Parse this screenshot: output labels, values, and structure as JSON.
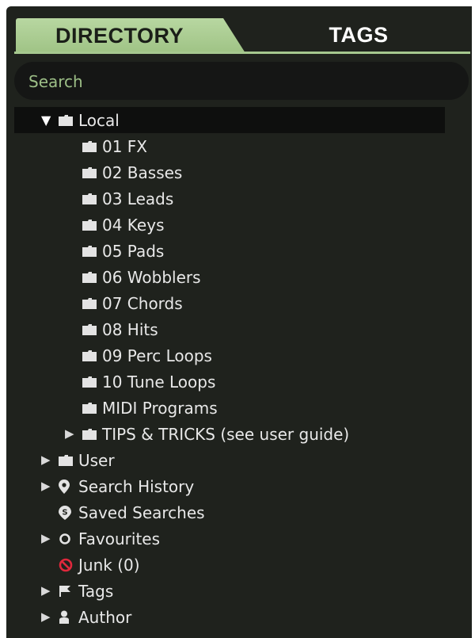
{
  "tabs": {
    "active": "DIRECTORY",
    "inactive": "TAGS"
  },
  "search": {
    "placeholder": "Search"
  },
  "tree": {
    "local": "Local",
    "folders": [
      "01 FX",
      "02 Basses",
      "03 Leads",
      "04 Keys",
      "05 Pads",
      "06 Wobblers",
      "07 Chords",
      "08 Hits",
      "09 Perc Loops",
      "10 Tune Loops",
      "MIDI Programs"
    ],
    "tips": "TIPS & TRICKS (see user guide)",
    "user": "User",
    "search_history": "Search History",
    "saved_searches": "Saved Searches",
    "favourites": "Favourites",
    "junk": "Junk (0)",
    "tags": "Tags",
    "author": "Author"
  },
  "colors": {
    "accent": "#a6c88f",
    "panel": "#1f221d",
    "junk": "#e0283c"
  },
  "icons": [
    "folder-icon",
    "location-pin-icon",
    "saved-search-icon",
    "circle-icon",
    "no-entry-icon",
    "flag-icon",
    "person-icon",
    "triangle-right-icon",
    "triangle-down-icon"
  ]
}
